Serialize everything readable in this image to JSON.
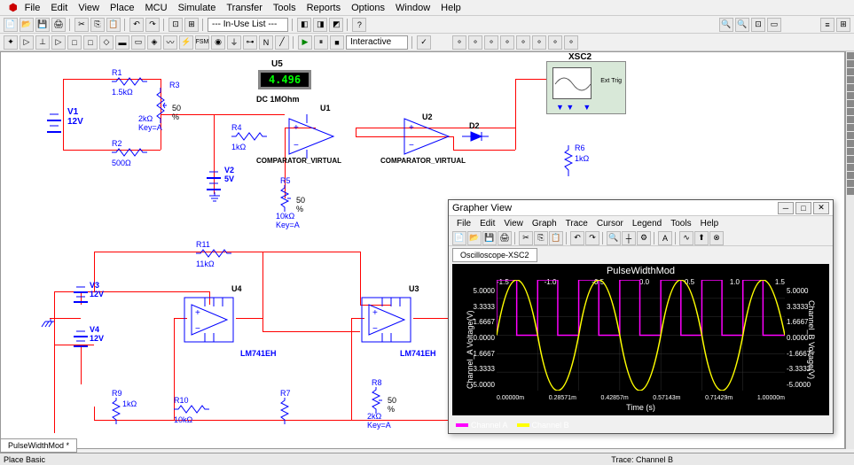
{
  "menubar": [
    "File",
    "Edit",
    "View",
    "Place",
    "MCU",
    "Simulate",
    "Transfer",
    "Tools",
    "Reports",
    "Options",
    "Window",
    "Help"
  ],
  "toolbar1_dropdown": "--- In-Use List ---",
  "toolbar2_dropdown": "Interactive",
  "components": {
    "R1": {
      "name": "R1",
      "value": "1.5kΩ"
    },
    "R2": {
      "name": "R2",
      "value": "500Ω"
    },
    "R3": {
      "name": "R3",
      "value": "2kΩ",
      "percent": "50 %",
      "key": "Key=A"
    },
    "R4": {
      "name": "R4",
      "value": "1kΩ"
    },
    "R5": {
      "name": "R5",
      "value": "10kΩ",
      "percent": "50 %",
      "key": "Key=A"
    },
    "R6": {
      "name": "R6",
      "value": "1kΩ"
    },
    "R7": {
      "name": "R7"
    },
    "R8": {
      "name": "R8",
      "value": "2kΩ",
      "percent": "50 %",
      "key": "Key=A"
    },
    "R9": {
      "name": "R9",
      "value": "1kΩ"
    },
    "R10": {
      "name": "R10",
      "value": "10kΩ"
    },
    "R11": {
      "name": "R11",
      "value": "11kΩ"
    },
    "V1": {
      "name": "V1",
      "value": "12V"
    },
    "V2": {
      "name": "V2",
      "value": "5V"
    },
    "V3": {
      "name": "V3",
      "value": "12V"
    },
    "V4": {
      "name": "V4",
      "value": "12V"
    },
    "U1": {
      "name": "U1",
      "type": "COMPARATOR_VIRTUAL"
    },
    "U2": {
      "name": "U2",
      "type": "COMPARATOR_VIRTUAL"
    },
    "U3": {
      "name": "U3",
      "type": "LM741EH"
    },
    "U4": {
      "name": "U4",
      "type": "LM741EH"
    },
    "U5": {
      "name": "U5",
      "value": "4.496",
      "sub": "DC  1MOhm"
    },
    "D2": {
      "name": "D2"
    },
    "XSC2": {
      "name": "XSC2",
      "tag": "Ext Trig"
    }
  },
  "grapher": {
    "title": "Grapher View",
    "menu": [
      "File",
      "Edit",
      "View",
      "Graph",
      "Trace",
      "Cursor",
      "Legend",
      "Tools",
      "Help"
    ],
    "tab": "Oscilloscope-XSC2",
    "plot_title": "PulseWidthMod",
    "xlabel": "Time (s)",
    "ylabel_left": "Channel_A Voltage(V)",
    "ylabel_right": "Channel_B Voltage(V)",
    "x_ticks_top": [
      "-1.5",
      "-1.0",
      "-0.5",
      "0.0",
      "0.5",
      "1.0",
      "1.5"
    ],
    "x_ticks_bottom": [
      "0.00000m",
      "0.28571m",
      "0.42857m",
      "0.57143m",
      "0.71429m",
      "1.00000m"
    ],
    "y_ticks_left": [
      "5.0000",
      "3.3333",
      "1.6667",
      "0.0000",
      "-1.6667",
      "-3.3333",
      "-5.0000"
    ],
    "y_ticks_right": [
      "5.0000",
      "3.3333",
      "1.6667",
      "0.0000",
      "-1.6667",
      "-3.3333",
      "-5.0000"
    ],
    "legend": [
      {
        "name": "Channel A",
        "color": "#f0f"
      },
      {
        "name": "Channel B",
        "color": "#ff0"
      }
    ]
  },
  "chart_data": {
    "type": "line",
    "title": "PulseWidthMod",
    "xlabel": "Time (s)",
    "ylabel": "Voltage (V)",
    "xlim": [
      0,
      0.001
    ],
    "ylim": [
      -5,
      5
    ],
    "series": [
      {
        "name": "Channel A",
        "color": "#ff00ff",
        "type": "square",
        "period_s": 0.000143,
        "low": 0.0,
        "high": 5.0,
        "duty": 0.5
      },
      {
        "name": "Channel B",
        "color": "#ffff00",
        "type": "sine",
        "period_s": 0.000143,
        "amplitude": 5.0,
        "offset": 0.0
      }
    ]
  },
  "doc_tab": "PulseWidthMod *",
  "status_left": "Place Basic",
  "status_right": "Trace: Channel B"
}
